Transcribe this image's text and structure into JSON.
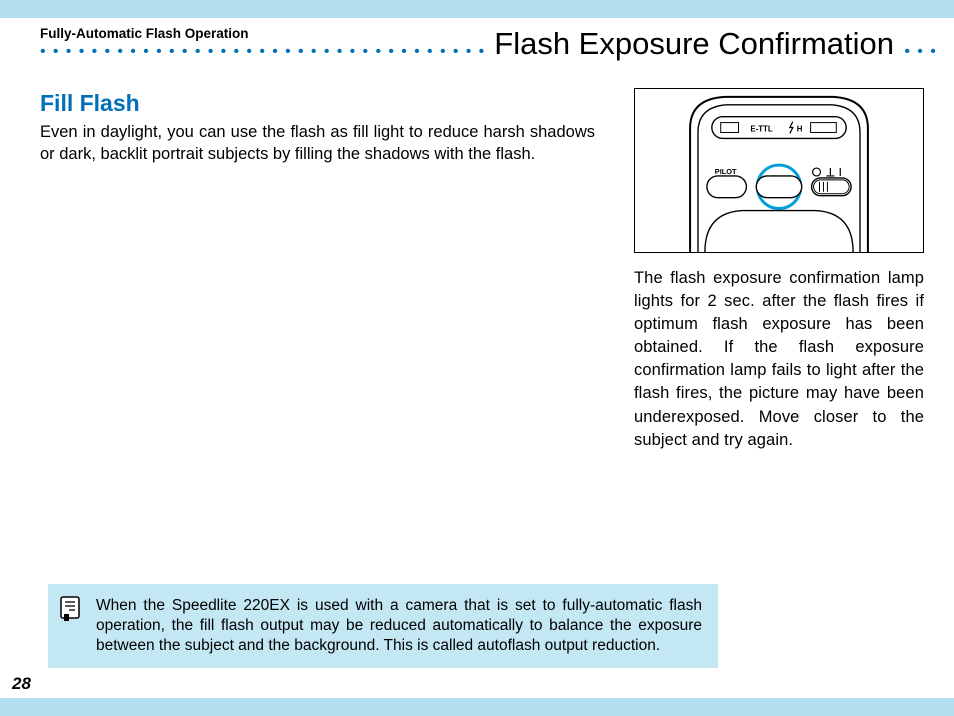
{
  "breadcrumb": "Fully-Automatic Flash Operation",
  "page_title": "Flash Exposure Confirmation",
  "left": {
    "heading": "Fill Flash",
    "body": "Even in daylight, you can use the flash as fill light to reduce harsh shadows or dark, backlit portrait subjects by filling the shadows with the flash."
  },
  "diagram": {
    "label_ettl": "E-TTL",
    "label_h": "H",
    "label_pilot": "PILOT"
  },
  "right": {
    "body": "The flash exposure confirmation lamp lights for 2 sec. after the flash fires if optimum flash expo­sure has been obtained. If the flash exposure confirmation lamp fails to light after the flash fires, the picture may have been underexposed. Move closer to the subject and try again."
  },
  "note": {
    "text": "When the Speedlite 220EX is used with a camera that is set to fully-auto­matic flash operation, the fill flash output may be reduced automatically to balance the exposure between the subject and the background. This is called autoflash output reduction."
  },
  "page_number": "28"
}
